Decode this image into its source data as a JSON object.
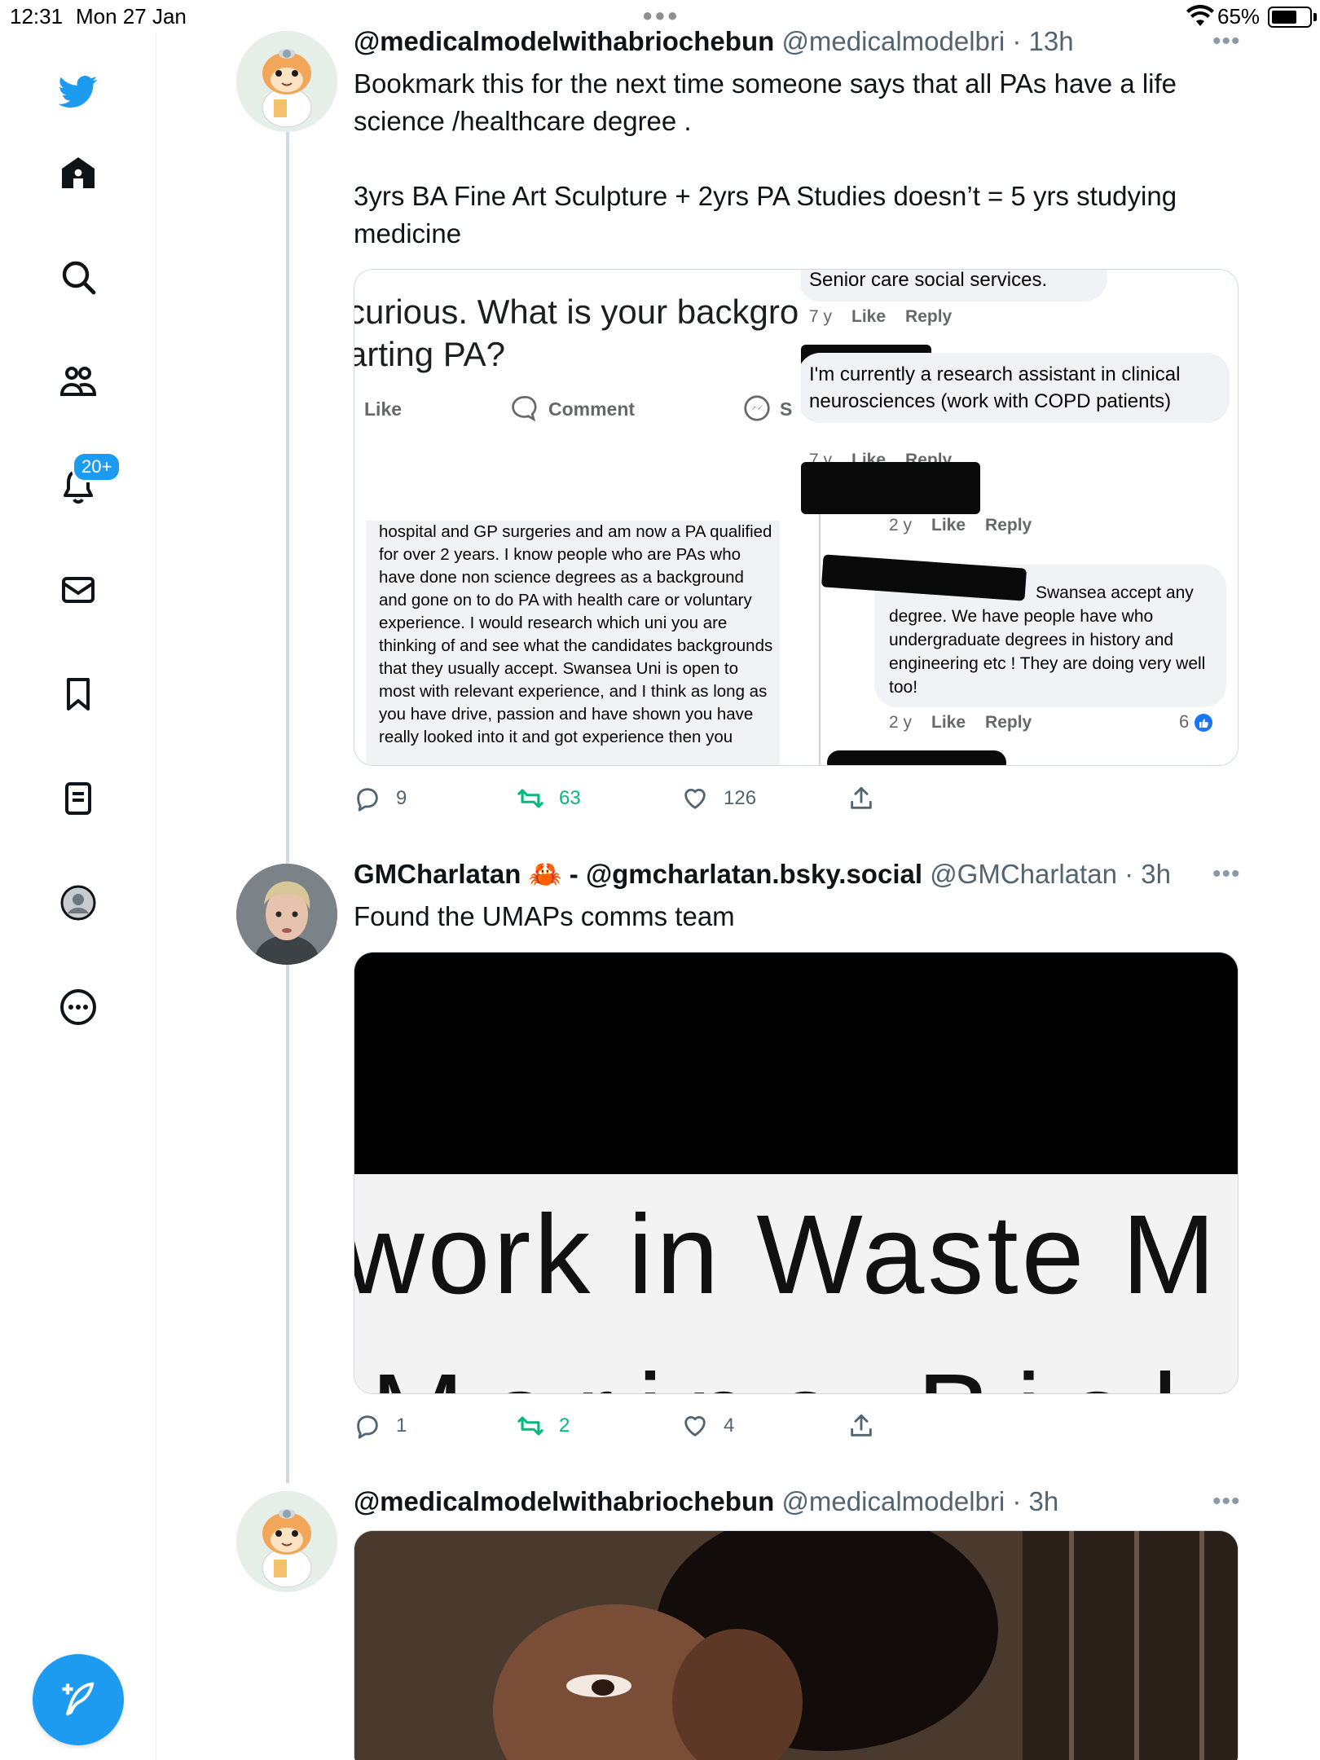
{
  "status_bar": {
    "time": "12:31",
    "date": "Mon 27 Jan",
    "battery": "65%",
    "battery_level": 0.65
  },
  "sidebar": {
    "notifications_badge": "20+",
    "accent_color": "#1d9bf0"
  },
  "tweets": [
    {
      "display_name": "@medicalmodelwithabriochebun",
      "handle_time": "@medicalmodelbri · 13h",
      "text_lines": [
        "Bookmark this for the next time someone says that all PAs have a life science /healthcare degree .",
        "",
        "3yrs BA Fine Art Sculpture + 2yrs PA Studies doesn’t = 5 yrs studying medicine"
      ],
      "media": {
        "question": "curious. What is your backgrou",
        "question2": "arting PA?",
        "like": "Like",
        "comment": "Comment",
        "share_partial": "S",
        "c1_text": "Senior care social services.",
        "c1_age": "7 y",
        "like_label": "Like",
        "reply_label": "Reply",
        "c2_text": "I'm currently a research assistant in clinical neurosciences (work with COPD patients)",
        "c2_age": "7 y",
        "c3_age": "2 y",
        "c4_text": "Swansea accept any degree. We have people have who undergraduate degrees in history and engineering etc ! They are doing very well too!",
        "c4_age": "2 y",
        "c4_reactions": "6",
        "long_comment": "hospital and GP surgeries and am now a PA qualified for over 2 years. I know people who are PAs who have done non science degrees as a background and gone on to do PA with health care or voluntary experience. I would research which uni you are thinking of and see what the candidates backgrounds that they usually accept. Swansea Uni is open to most with relevant experience, and I think as long as you have drive, passion and have shown you have really looked into it and got experience then you"
      },
      "replies": "9",
      "retweets": "63",
      "likes": "126"
    },
    {
      "display_name": "GMCharlatan 🦀 - @gmcharlatan.bsky.social",
      "handle_time": "@GMCharlatan · 3h",
      "text": "Found the UMAPs comms team",
      "media_text": "work in Waste M",
      "media_text2": "Marine Biology",
      "replies": "1",
      "retweets": "2",
      "likes": "4"
    },
    {
      "display_name": "@medicalmodelwithabriochebun",
      "handle_time": "@medicalmodelbri · 3h"
    }
  ]
}
